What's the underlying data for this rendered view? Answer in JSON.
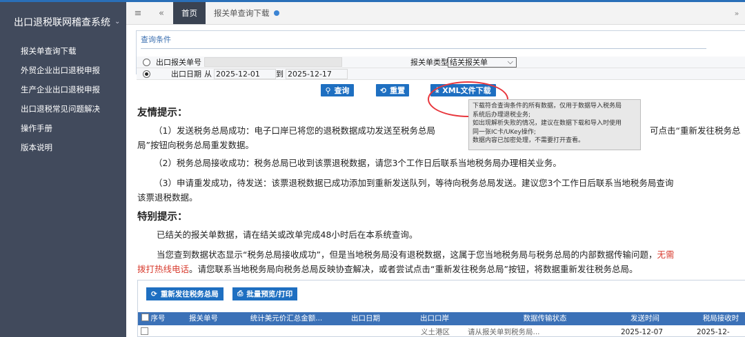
{
  "sidebar": {
    "title": "出口退税联网稽查系统",
    "items": [
      {
        "label": "报关单查询下载"
      },
      {
        "label": "外贸企业出口退税申报"
      },
      {
        "label": "生产企业出口退税申报"
      },
      {
        "label": "出口退税常见问题解决"
      },
      {
        "label": "操作手册"
      },
      {
        "label": "版本说明"
      }
    ]
  },
  "tabs": {
    "home": "首页",
    "active": "报关单查询下载"
  },
  "query": {
    "section_title": "查询条件",
    "opt1_label": "出口报关单号",
    "type_label": "报关单类型",
    "type_value": "结关报关单",
    "opt2_label": "出口日期",
    "from_label": "从",
    "from_date": "2025-12-01",
    "to_label": "到",
    "to_date": "2025-12-17",
    "search_btn": "查询",
    "reset_btn": "重置",
    "xml_btn": "XML文件下载"
  },
  "tooltip": {
    "lines": [
      "下载符合查询条件的所有数据，仅用于数据导入税务局",
      "系统后办理退税业务;",
      "如出现解析失败的情况，建议在数据下载和导入时使用",
      "同一张IC卡/UKey操作;",
      "数据内容已加密处理，不需要打开查看。"
    ]
  },
  "tips": {
    "title1": "友情提示：",
    "p1_main": "（1）发送税务总局成功：电子口岸已将您的退税数据成功发送至税务总局",
    "p1_tail": "可点击“重新发往税务总",
    "p1_line2": "局”按钮向税务总局重发数据。",
    "p2": "（2）税务总局接收成功：税务总局已收到该票退税数据，请您3个工作日后联系当地税务局办理相关业务。",
    "p3_line1": "（3）申请重发成功，待发送：该票退税数据已成功添加到重新发送队列，等待向税务总局发送。建议您3个工作日后联系当地税务局查询",
    "p3_line2": "该票退税数据。",
    "title2": "特别提示：",
    "s1": "已结关的报关单数据，请在结关或改单完成48小时后在本系统查询。",
    "s2_line1": "当您查到数据状态显示“税务总局接收成功”，但是当地税务局没有退税数据，这属于您当地税务局与税务总局的内部数据传输问题，",
    "s2_red1": "无需",
    "s2_red2": "拨打热线电话",
    "s2_line2_rest": "。请您联系当地税务局向税务总局反映协查解决，或者尝试点击“重新发往税务总局”按钮，将数据重新发往税务总局。"
  },
  "grid": {
    "resend_btn": "重新发往税务总局",
    "print_btn": "批量预览/打印",
    "headers": [
      "序号",
      "报关单号",
      "统计美元价汇总金额...",
      "出口日期",
      "出口口岸",
      "数据传输状态",
      "发送时间",
      "税局接收时"
    ],
    "row": {
      "port": "义土港区",
      "status": "请从报关单到税务局...",
      "send_time": "2025-12-07",
      "recv_time": "2025-12-"
    }
  },
  "colors": {
    "sidebar_bg": "#414a5c",
    "accent_blue": "#1e6fc1",
    "table_header": "#3b71b7",
    "warning_red": "#d83c2f"
  }
}
